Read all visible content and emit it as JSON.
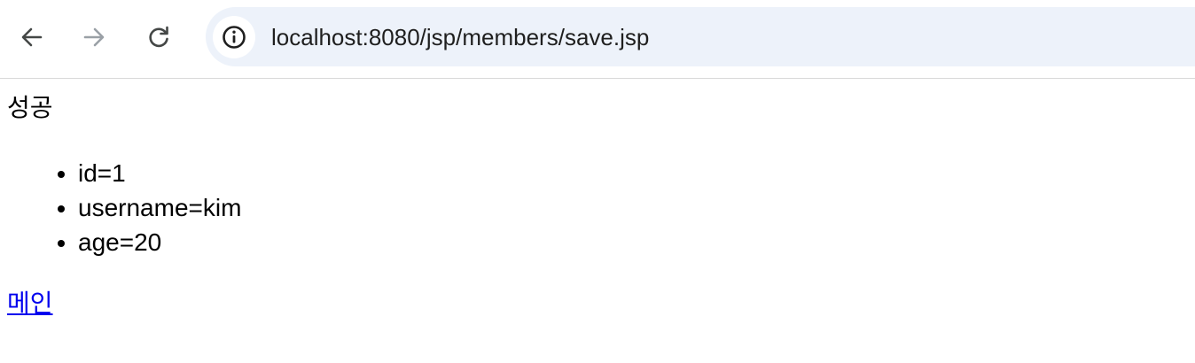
{
  "browser": {
    "url": "localhost:8080/jsp/members/save.jsp",
    "back_icon": "arrow-left-icon",
    "forward_icon": "arrow-right-icon",
    "reload_icon": "reload-icon",
    "site_info_icon": "info-icon"
  },
  "page": {
    "status": "성공",
    "items": [
      "id=1",
      "username=kim",
      "age=20"
    ],
    "link_label": "메인",
    "link_color": "#0000ee"
  }
}
